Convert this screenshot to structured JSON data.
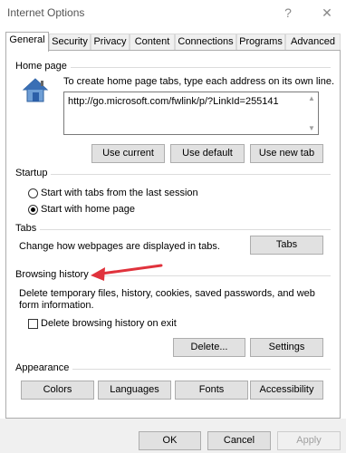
{
  "window": {
    "title": "Internet Options",
    "help_glyph": "?",
    "close_glyph": "✕"
  },
  "tabs": [
    {
      "label": "General",
      "active": true
    },
    {
      "label": "Security"
    },
    {
      "label": "Privacy"
    },
    {
      "label": "Content"
    },
    {
      "label": "Connections"
    },
    {
      "label": "Programs"
    },
    {
      "label": "Advanced"
    }
  ],
  "home_page": {
    "section_title": "Home page",
    "description": "To create home page tabs, type each address on its own line.",
    "url_value": "http://go.microsoft.com/fwlink/p/?LinkId=255141",
    "use_current_label": "Use current",
    "use_default_label": "Use default",
    "use_new_tab_label": "Use new tab"
  },
  "startup": {
    "section_title": "Startup",
    "option_tabs_last_session": "Start with tabs from the last session",
    "option_home_page": "Start with home page",
    "selected": "home_page"
  },
  "tabs_section": {
    "section_title": "Tabs",
    "description": "Change how webpages are displayed in tabs.",
    "button_label": "Tabs"
  },
  "browsing_history": {
    "section_title": "Browsing history",
    "description_line1": "Delete temporary files, history, cookies, saved passwords, and web",
    "description_line2": "form information.",
    "delete_on_exit_label": "Delete browsing history on exit",
    "delete_on_exit_checked": false,
    "delete_button_label": "Delete...",
    "settings_button_label": "Settings"
  },
  "appearance": {
    "section_title": "Appearance",
    "colors_label": "Colors",
    "languages_label": "Languages",
    "fonts_label": "Fonts",
    "accessibility_label": "Accessibility"
  },
  "footer": {
    "ok_label": "OK",
    "cancel_label": "Cancel",
    "apply_label": "Apply"
  },
  "colors": {
    "annotation_arrow": "#e0323c"
  }
}
